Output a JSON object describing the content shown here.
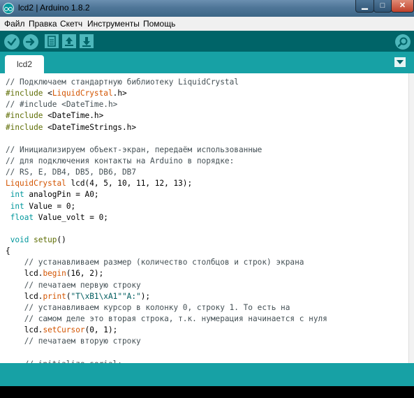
{
  "window": {
    "title": "lcd2 | Arduino 1.8.2",
    "controls": {
      "minimize": "▁",
      "maximize": "□",
      "close": "✕"
    }
  },
  "menu": [
    "Файл",
    "Правка",
    "Скетч",
    "Инструменты",
    "Помощь"
  ],
  "toolbar": {
    "buttons": [
      "verify-icon",
      "upload-icon",
      "new-icon",
      "open-icon",
      "save-icon"
    ],
    "serial_monitor": "magnifier-icon"
  },
  "tabs": [
    {
      "label": "lcd2"
    }
  ],
  "colors": {
    "toolbar": "#006468",
    "tabs_bar": "#17a1a5",
    "comment": "#434f54",
    "keyword": "#00979c",
    "preprocessor": "#5e6d03",
    "function": "#d35400"
  },
  "code": [
    [
      {
        "t": "// Подключаем стандартную библиотеку LiquidCrystal",
        "c": "c"
      }
    ],
    [
      {
        "t": "#include ",
        "c": "p"
      },
      {
        "t": "<",
        "c": ""
      },
      {
        "t": "LiquidCrystal",
        "c": "f"
      },
      {
        "t": ".h>",
        "c": ""
      }
    ],
    [
      {
        "t": "// #include <DateTime.h>",
        "c": "c"
      }
    ],
    [
      {
        "t": "#include ",
        "c": "p"
      },
      {
        "t": "<DateTime.h>",
        "c": ""
      }
    ],
    [
      {
        "t": "#include ",
        "c": "p"
      },
      {
        "t": "<DateTimeStrings.h>",
        "c": ""
      }
    ],
    [],
    [
      {
        "t": "// Инициализируем объект-экран, передаём использованные",
        "c": "c"
      }
    ],
    [
      {
        "t": "// для подключения контакты на Arduino в порядке:",
        "c": "c"
      }
    ],
    [
      {
        "t": "// RS, E, DB4, DB5, DB6, DB7",
        "c": "c"
      }
    ],
    [
      {
        "t": "LiquidCrystal",
        "c": "f"
      },
      {
        "t": " lcd(4, 5, 10, 11, 12, 13);",
        "c": ""
      }
    ],
    [
      {
        "t": " ",
        "c": ""
      },
      {
        "t": "int",
        "c": "k"
      },
      {
        "t": " analogPin = A0;",
        "c": ""
      }
    ],
    [
      {
        "t": " ",
        "c": ""
      },
      {
        "t": "int",
        "c": "k"
      },
      {
        "t": " Value = 0;",
        "c": ""
      }
    ],
    [
      {
        "t": " ",
        "c": ""
      },
      {
        "t": "float",
        "c": "k"
      },
      {
        "t": " Value_volt = 0;",
        "c": ""
      }
    ],
    [],
    [
      {
        "t": " ",
        "c": ""
      },
      {
        "t": "void",
        "c": "k"
      },
      {
        "t": " ",
        "c": ""
      },
      {
        "t": "setup",
        "c": "p"
      },
      {
        "t": "()",
        "c": ""
      }
    ],
    [
      {
        "t": "{",
        "c": ""
      }
    ],
    [
      {
        "t": "    // устанавливаем размер (количество столбцов и строк) экрана",
        "c": "c"
      }
    ],
    [
      {
        "t": "    lcd.",
        "c": ""
      },
      {
        "t": "begin",
        "c": "f"
      },
      {
        "t": "(16, 2);",
        "c": ""
      }
    ],
    [
      {
        "t": "    // печатаем первую строку",
        "c": "c"
      }
    ],
    [
      {
        "t": "    lcd.",
        "c": ""
      },
      {
        "t": "print",
        "c": "f"
      },
      {
        "t": "(",
        "c": ""
      },
      {
        "t": "\"T\\xB1\\xA1\"\"A:\"",
        "c": "s"
      },
      {
        "t": ");",
        "c": ""
      }
    ],
    [
      {
        "t": "    // устанавливаем курсор в колонку 0, строку 1. То есть на",
        "c": "c"
      }
    ],
    [
      {
        "t": "    // самом деле это вторая строка, т.к. нумерация начинается с нуля",
        "c": "c"
      }
    ],
    [
      {
        "t": "    lcd.",
        "c": ""
      },
      {
        "t": "setCursor",
        "c": "f"
      },
      {
        "t": "(0, 1);",
        "c": ""
      }
    ],
    [
      {
        "t": "    // печатаем вторую строку",
        "c": "c"
      }
    ],
    [],
    [
      {
        "t": "    // initialize serial:",
        "c": "c"
      }
    ]
  ]
}
